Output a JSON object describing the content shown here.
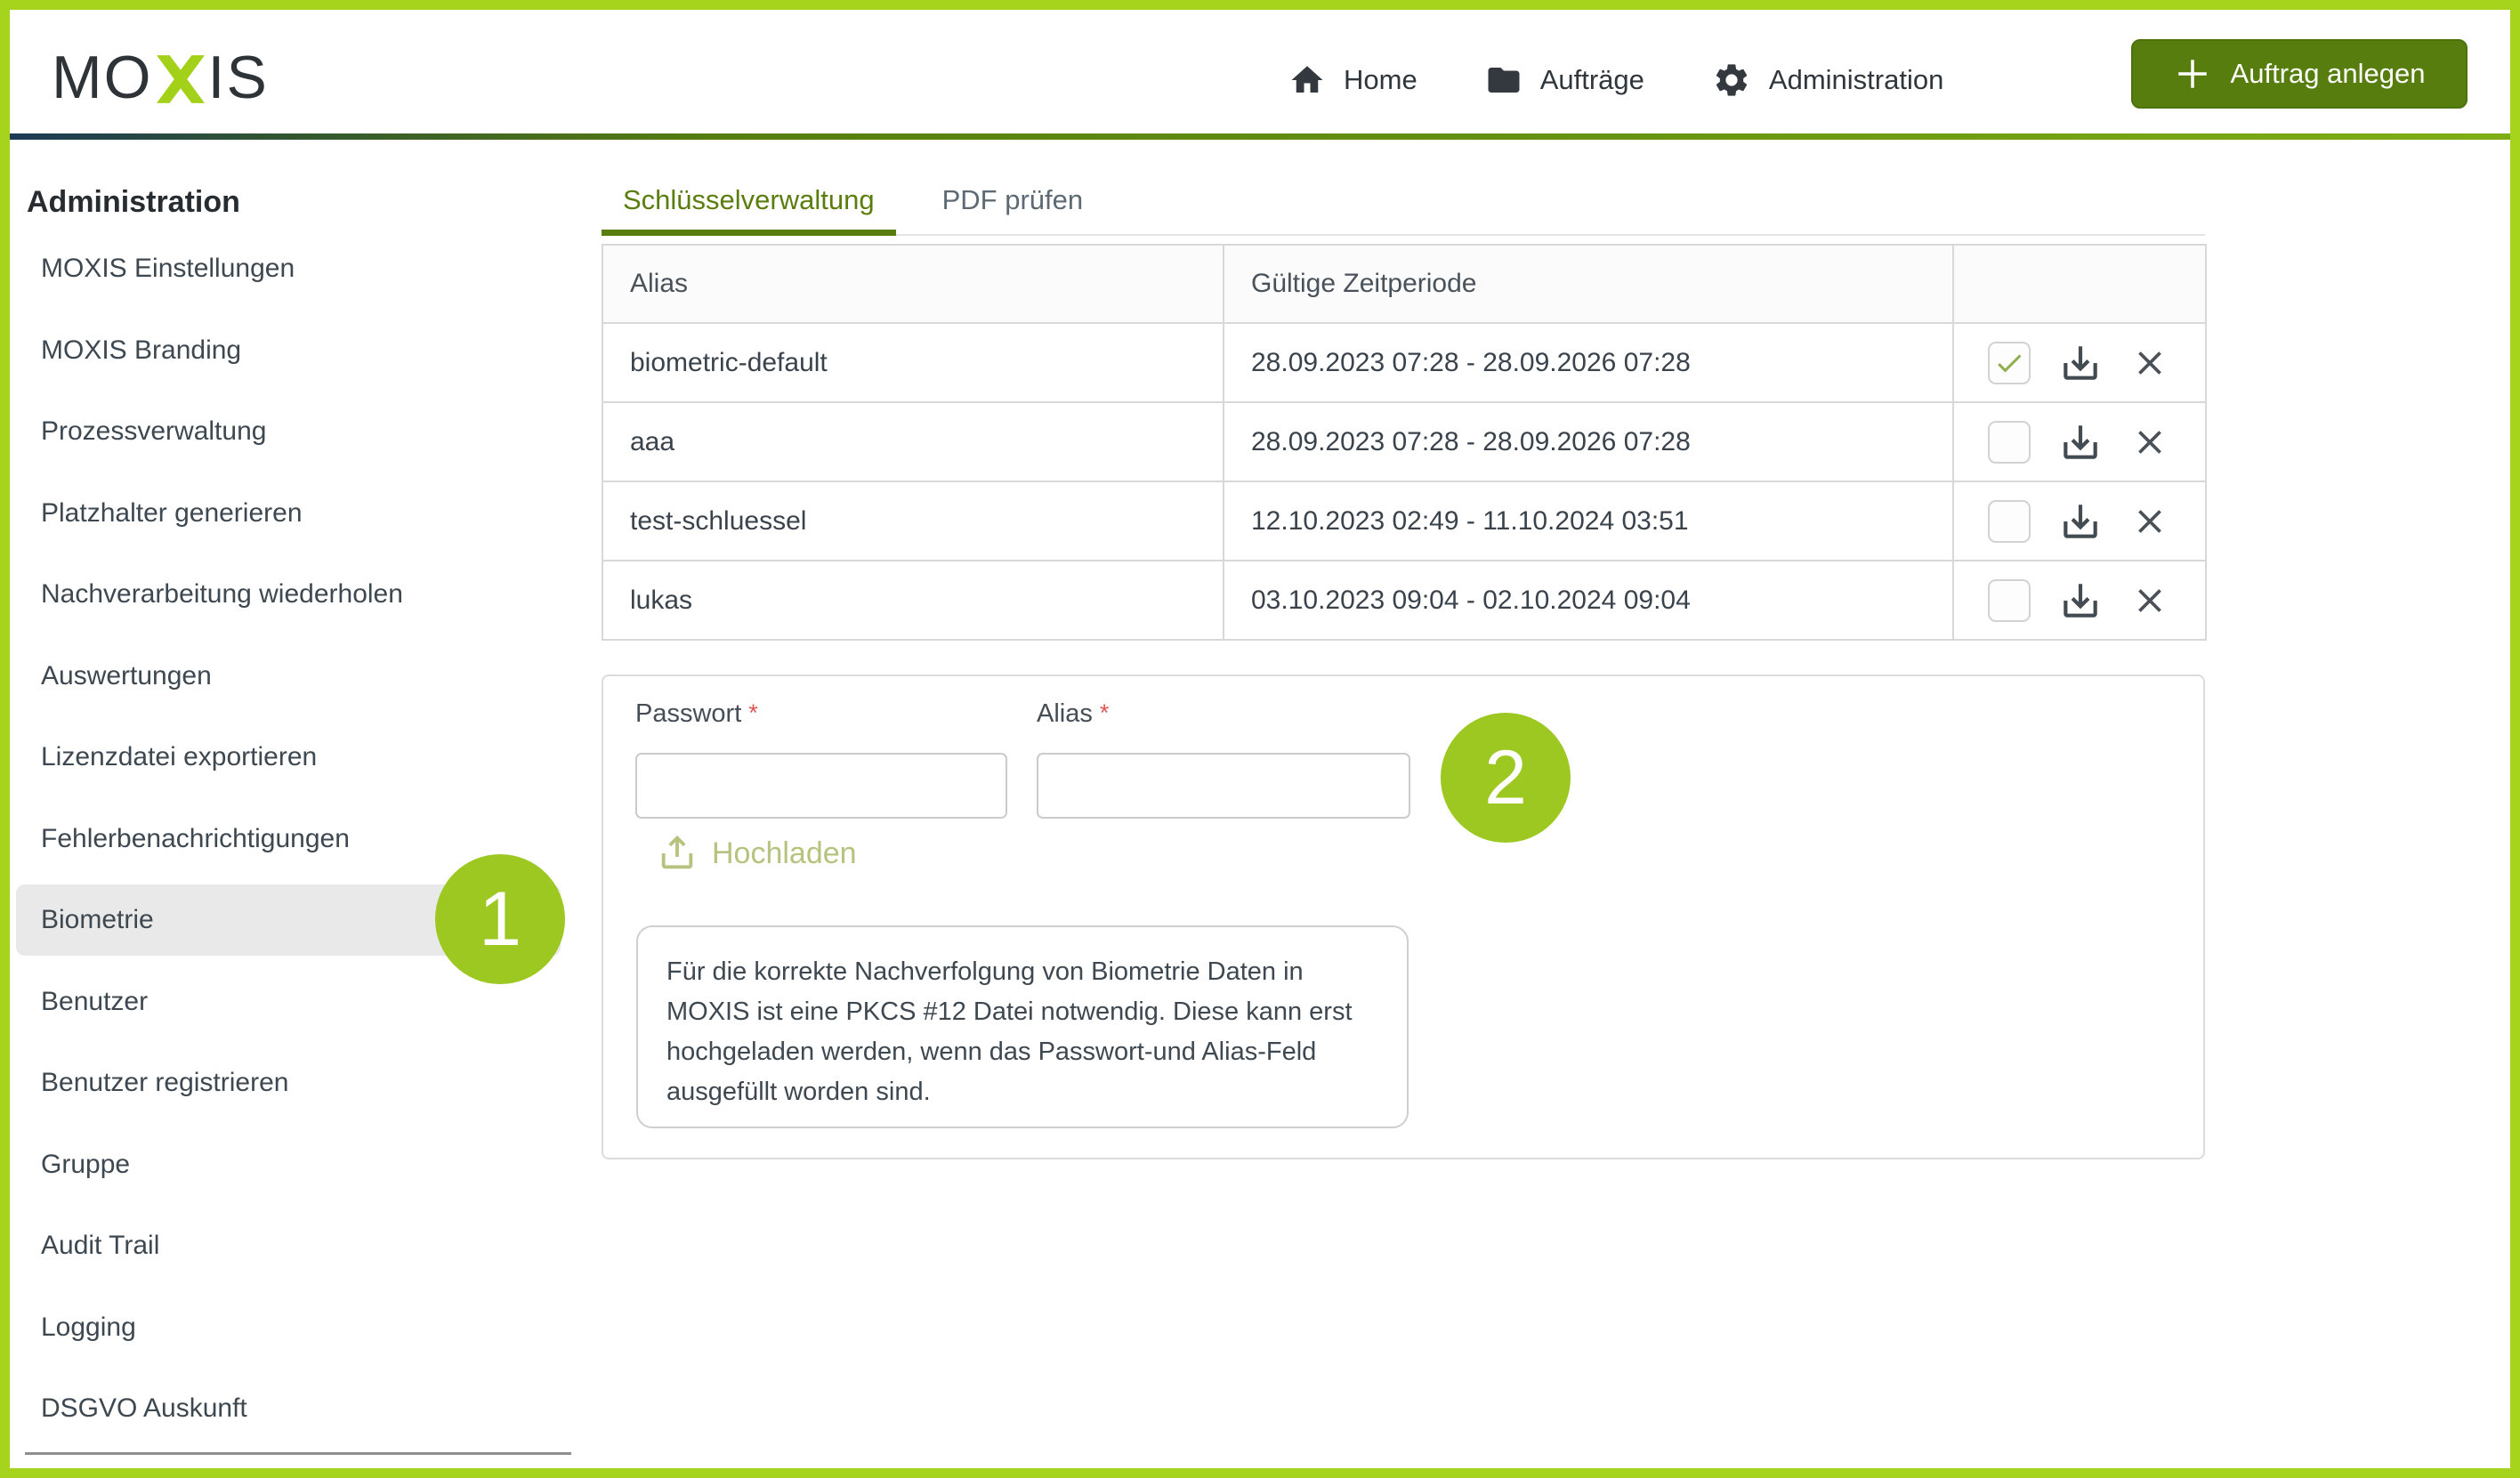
{
  "colors": {
    "frame_border": "#a6d41d",
    "annotation_green": "#9cc821",
    "primary_dark_green": "#567d0e",
    "active_tab_green": "#5a7d0e",
    "upload_light_green": "#b5c37e",
    "checkmark_green": "#8fae4e",
    "divider_gradient_left": "#1c3a57",
    "divider_gradient_right": "#7fae14",
    "required_red": "#e05555",
    "sidebar_highlight": "#e9e9e9"
  },
  "header": {
    "logo": {
      "left": "MO",
      "right": "IS"
    },
    "nav": [
      {
        "icon": "home-icon",
        "label": "Home"
      },
      {
        "icon": "folder-icon",
        "label": "Aufträge"
      },
      {
        "icon": "gear-icon",
        "label": "Administration"
      }
    ],
    "create_button_label": "Auftrag anlegen"
  },
  "sidebar": {
    "heading": "Administration",
    "active_item": "Biometrie",
    "items": [
      "MOXIS Einstellungen",
      "MOXIS Branding",
      "Prozessverwaltung",
      "Platzhalter generieren",
      "Nachverarbeitung wiederholen",
      "Auswertungen",
      "Lizenzdatei exportieren",
      "Fehlerbenachrichtigungen",
      "Biometrie",
      "Benutzer",
      "Benutzer registrieren",
      "Gruppe",
      "Audit Trail",
      "Logging",
      "DSGVO Auskunft"
    ]
  },
  "tabs": [
    {
      "label": "Schlüsselverwaltung",
      "active": true
    },
    {
      "label": "PDF prüfen",
      "active": false
    }
  ],
  "table": {
    "headers": [
      "Alias",
      "Gültige Zeitperiode",
      ""
    ],
    "rows": [
      {
        "alias": "biometric-default",
        "period": "28.09.2023 07:28 - 28.09.2026 07:28",
        "checked": true
      },
      {
        "alias": "aaa",
        "period": "28.09.2023 07:28 - 28.09.2026 07:28",
        "checked": false
      },
      {
        "alias": "test-schluessel",
        "period": "12.10.2023 02:49 - 11.10.2024 03:51",
        "checked": false
      },
      {
        "alias": "lukas",
        "period": "03.10.2023 09:04 - 02.10.2024 09:04",
        "checked": false
      }
    ]
  },
  "form": {
    "password_label": "Passwort",
    "alias_label": "Alias",
    "required_marker": "*",
    "password_value": "",
    "alias_value": "",
    "upload_label": "Hochladen",
    "info_text": "Für die korrekte Nachverfolgung von Biometrie Daten in MOXIS ist eine PKCS #12 Datei notwendig. Diese kann erst hochgeladen werden, wenn das Passwort-und Alias-Feld ausgefüllt worden sind."
  },
  "annotations": {
    "one": "1",
    "two": "2"
  }
}
